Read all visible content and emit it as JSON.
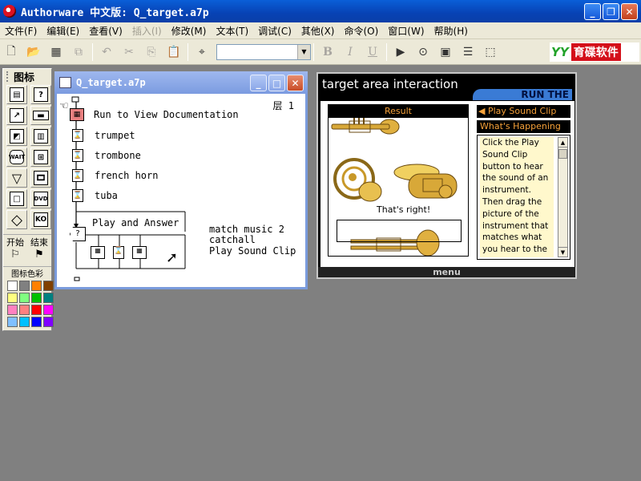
{
  "app": {
    "title": "Authorware 中文版: Q_target.a7p"
  },
  "menu": [
    "文件(F)",
    "编辑(E)",
    "查看(V)",
    "插入(I)",
    "修改(M)",
    "文本(T)",
    "调试(C)",
    "其他(X)",
    "命令(O)",
    "窗口(W)",
    "帮助(H)"
  ],
  "menu_disabled": [
    "插入(I)"
  ],
  "toolbar": {
    "bold": "B",
    "italic": "I",
    "underline": "U",
    "font_combo_value": ""
  },
  "logo": {
    "text": "育碟软件",
    "yy": "YY"
  },
  "icon_palette": {
    "title": "图标",
    "icons": [
      "display-icon",
      "decision-icon",
      "motion-icon",
      "interaction-icon",
      "erase-icon",
      "calculation-icon",
      "wait-icon",
      "map-icon",
      "navigate-icon",
      "movie-icon",
      "framework-icon",
      "dvd-icon",
      "decision-diamond-icon",
      "knowledge-object-icon"
    ],
    "start_label": "开始",
    "end_label": "结束",
    "color_label": "图标色彩",
    "colors": [
      "#ffffff",
      "#808080",
      "#ff8000",
      "#804000",
      "#ffff80",
      "#80ff80",
      "#00c000",
      "#008080",
      "#ff80c0",
      "#ff8080",
      "#ff0000",
      "#ff00ff",
      "#80c0ff",
      "#00c0ff",
      "#0000ff",
      "#8000ff"
    ]
  },
  "flowline": {
    "title": "Q_target.a7p",
    "layer": "层 1",
    "items": [
      "Run to View Documentation",
      "trumpet",
      "trombone",
      "french horn",
      "tuba"
    ],
    "interaction": "Play and Answer",
    "responses": [
      "match music 2",
      "catchall",
      "Play Sound Clip"
    ]
  },
  "presentation": {
    "title": "target area interaction",
    "run_example": "RUN THE EXAMPLE",
    "result_header": "Result",
    "play_sound": "◀ Play Sound Clip",
    "whats_happening": "What's Happening",
    "explanation": "Click the Play Sound Clip button to hear the sound of an instrument. Then drag the picture of the instrument that matches what you hear to the bottom of the window.",
    "feedback": "That's right!",
    "menu": "menu"
  }
}
